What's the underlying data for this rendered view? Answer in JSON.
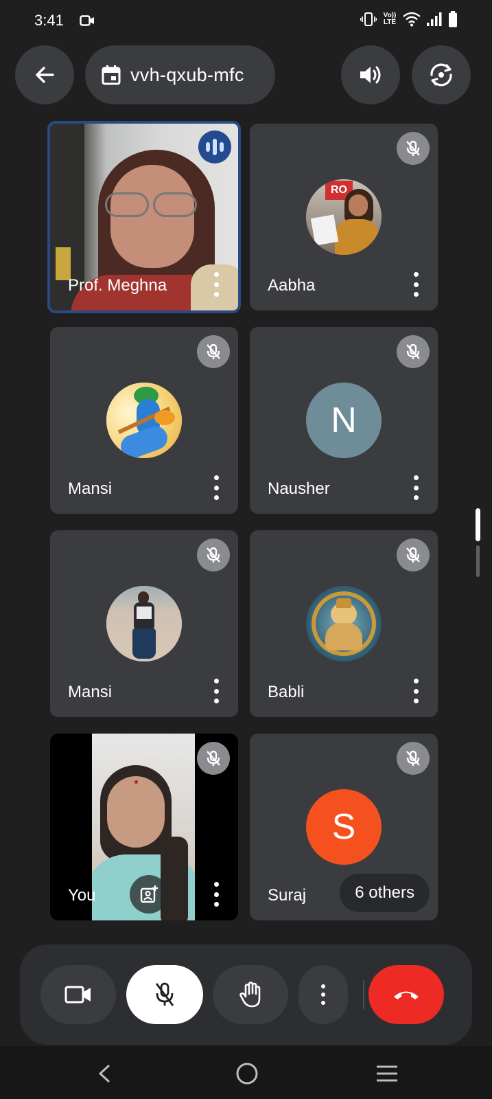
{
  "status_bar": {
    "time": "3:41",
    "icons": [
      "screen-record-icon",
      "vibrate-icon",
      "volte-icon",
      "wifi-icon",
      "signal-icon",
      "battery-icon"
    ],
    "volte_label": "Vo)) LTE"
  },
  "top_bar": {
    "meeting_code": "vvh-qxub-mfc",
    "icons": [
      "back-arrow-icon",
      "calendar-icon",
      "speaker-icon",
      "switch-camera-icon"
    ]
  },
  "participants": [
    {
      "name": "Prof. Meghna",
      "speaking": true,
      "muted": false,
      "display": "video"
    },
    {
      "name": "Aabha",
      "muted": true,
      "display": "photo-avatar"
    },
    {
      "name": "Mansi",
      "muted": true,
      "display": "illustration-avatar"
    },
    {
      "name": "Nausher",
      "muted": true,
      "display": "letter-avatar",
      "initial": "N",
      "avatar_color": "#6f8d99"
    },
    {
      "name": "Mansi",
      "muted": true,
      "display": "photo-avatar"
    },
    {
      "name": "Babli",
      "muted": true,
      "display": "illustration-avatar"
    },
    {
      "name": "You",
      "muted": true,
      "display": "video"
    },
    {
      "name": "Suraj",
      "muted": true,
      "display": "letter-avatar",
      "initial": "S",
      "avatar_color": "#f4511e"
    }
  ],
  "others": {
    "label": "6 others"
  },
  "controls": [
    "camera-icon",
    "mic-off-icon",
    "raise-hand-icon",
    "more-options-icon",
    "end-call-icon"
  ],
  "colors": {
    "background": "#1f1f1f",
    "tile": "#3b3c3f",
    "active_border": "#2a4a85",
    "end_call": "#ee2a24"
  }
}
